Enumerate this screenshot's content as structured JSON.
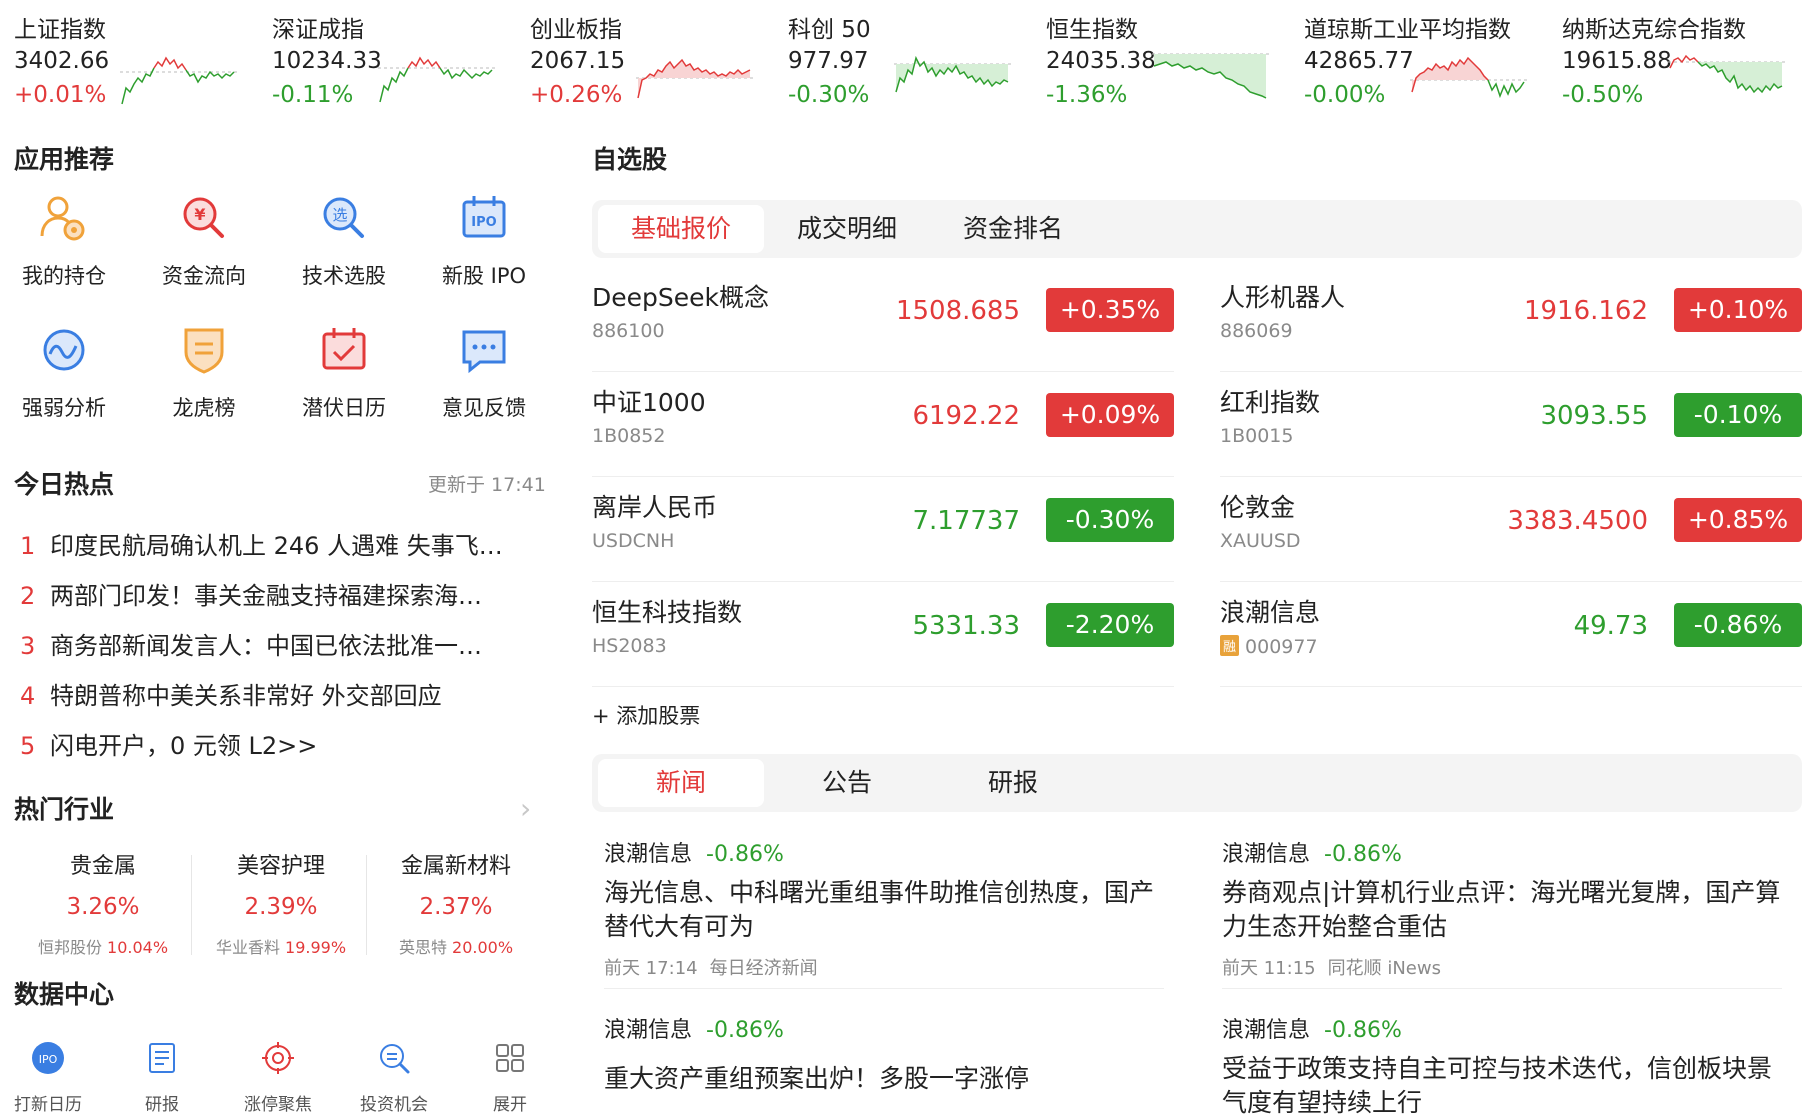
{
  "tickers": [
    {
      "name": "上证指数",
      "price": "3402.66",
      "change": "+0.01%",
      "dir": "up"
    },
    {
      "name": "深证成指",
      "price": "10234.33",
      "change": "-0.11%",
      "dir": "down"
    },
    {
      "name": "创业板指",
      "price": "2067.15",
      "change": "+0.26%",
      "dir": "up"
    },
    {
      "name": "科创 50",
      "price": "977.97",
      "change": "-0.30%",
      "dir": "down"
    },
    {
      "name": "恒生指数",
      "price": "24035.38",
      "change": "-1.36%",
      "dir": "down"
    },
    {
      "name": "道琼斯工业平均指数",
      "price": "42865.77",
      "change": "-0.00%",
      "dir": "down"
    },
    {
      "name": "纳斯达克综合指数",
      "price": "19615.88",
      "change": "-0.50%",
      "dir": "down"
    }
  ],
  "apps": {
    "title": "应用推荐",
    "items": [
      {
        "label": "我的持仓",
        "icon": "position-icon"
      },
      {
        "label": "资金流向",
        "icon": "capital-flow-icon"
      },
      {
        "label": "技术选股",
        "icon": "stock-pick-icon"
      },
      {
        "label": "新股 IPO",
        "icon": "ipo-icon"
      },
      {
        "label": "强弱分析",
        "icon": "strength-icon"
      },
      {
        "label": "龙虎榜",
        "icon": "dragon-tiger-icon"
      },
      {
        "label": "潜伏日历",
        "icon": "calendar-icon"
      },
      {
        "label": "意见反馈",
        "icon": "feedback-icon"
      }
    ]
  },
  "hot": {
    "title": "今日热点",
    "updated": "更新于 17:41",
    "items": [
      {
        "num": "1",
        "text": "印度民航局确认机上 246 人遇难 失事飞…"
      },
      {
        "num": "2",
        "text": "两部门印发！事关金融支持福建探索海…"
      },
      {
        "num": "3",
        "text": "商务部新闻发言人：中国已依法批准一…"
      },
      {
        "num": "4",
        "text": "特朗普称中美关系非常好 外交部回应"
      },
      {
        "num": "5",
        "text": "闪电开户，0 元领 L2>>"
      }
    ]
  },
  "industry": {
    "title": "热门行业",
    "chevron": "›",
    "items": [
      {
        "name": "贵金属",
        "pct": "3.26%",
        "stock": "恒邦股份",
        "stock_pct": "10.04%"
      },
      {
        "name": "美容护理",
        "pct": "2.39%",
        "stock": "华业香料",
        "stock_pct": "19.99%"
      },
      {
        "name": "金属新材料",
        "pct": "2.37%",
        "stock": "英思特",
        "stock_pct": "20.00%"
      }
    ]
  },
  "data_center": {
    "title": "数据中心",
    "items": [
      {
        "label": "打新日历",
        "icon": "ipo-calendar-icon",
        "icon_text": "IPO"
      },
      {
        "label": "研报",
        "icon": "report-icon"
      },
      {
        "label": "涨停聚焦",
        "icon": "target-icon"
      },
      {
        "label": "投资机会",
        "icon": "opportunity-icon"
      },
      {
        "label": "展开",
        "icon": "grid-icon"
      }
    ]
  },
  "watchlist": {
    "title": "自选股",
    "tabs": [
      "基础报价",
      "成交明细",
      "资金排名"
    ],
    "active_tab": 0,
    "stocks": [
      {
        "name": "DeepSeek概念",
        "code": "886100",
        "price": "1508.685",
        "change": "+0.35%",
        "dir": "up"
      },
      {
        "name": "人形机器人",
        "code": "886069",
        "price": "1916.162",
        "change": "+0.10%",
        "dir": "up"
      },
      {
        "name": "中证1000",
        "code": "1B0852",
        "price": "6192.22",
        "change": "+0.09%",
        "dir": "up"
      },
      {
        "name": "红利指数",
        "code": "1B0015",
        "price": "3093.55",
        "change": "-0.10%",
        "dir": "down"
      },
      {
        "name": "离岸人民币",
        "code": "USDCNH",
        "price": "7.17737",
        "change": "-0.30%",
        "dir": "down"
      },
      {
        "name": "伦敦金",
        "code": "XAUUSD",
        "price": "3383.4500",
        "change": "+0.85%",
        "dir": "up"
      },
      {
        "name": "恒生科技指数",
        "code": "HS2083",
        "price": "5331.33",
        "change": "-2.20%",
        "dir": "down"
      },
      {
        "name": "浪潮信息",
        "code": "000977",
        "badge": "融",
        "price": "49.73",
        "change": "-0.86%",
        "dir": "down"
      }
    ],
    "add_label": "+ 添加股票"
  },
  "news": {
    "tabs": [
      "新闻",
      "公告",
      "研报"
    ],
    "active_tab": 0,
    "items": [
      {
        "stock": "浪潮信息",
        "change": "-0.86%",
        "title": "海光信息、中科曙光重组事件助推信创热度，国产替代大有可为",
        "time": "前天 17:14",
        "source": "每日经济新闻"
      },
      {
        "stock": "浪潮信息",
        "change": "-0.86%",
        "title": "券商观点|计算机行业点评：海光曙光复牌，国产算力生态开始整合重估",
        "time": "前天 11:15",
        "source": "同花顺 iNews"
      },
      {
        "stock": "浪潮信息",
        "change": "-0.86%",
        "title": "重大资产重组预案出炉！多股一字涨停",
        "time": "",
        "source": ""
      },
      {
        "stock": "浪潮信息",
        "change": "-0.86%",
        "title": "受益于政策支持自主可控与技术迭代，信创板块景气度有望持续上行",
        "time": "",
        "source": ""
      }
    ]
  },
  "colors": {
    "up": "#e23a3a",
    "down": "#2e9e2e",
    "active_tab": "#e23a3a"
  }
}
